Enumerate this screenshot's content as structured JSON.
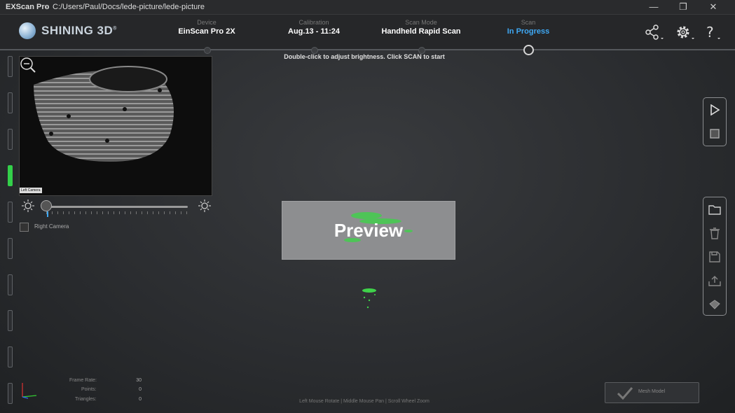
{
  "titlebar": {
    "app": "EXScan Pro",
    "sep": "-",
    "path": "C:/Users/Paul/Docs/lede-picture/lede-picture",
    "minimize": "—",
    "restore": "❐",
    "close": "✕"
  },
  "brand": {
    "name": "SHINING 3D",
    "reg": "®"
  },
  "steps": [
    {
      "label": "Device",
      "value": "EinScan Pro 2X"
    },
    {
      "label": "Calibration",
      "value": "Aug.13 - 11:24"
    },
    {
      "label": "Scan Mode",
      "value": "Handheld Rapid Scan"
    },
    {
      "label": "Scan",
      "value": "In Progress"
    }
  ],
  "hint": "Double-click to adjust brightness. Click SCAN to start",
  "camera": {
    "left_label": "Left Camera",
    "right_label": "Right Camera"
  },
  "preview": {
    "label": "Preview"
  },
  "stats": [
    {
      "label": "Frame Rate:",
      "value": "30"
    },
    {
      "label": "Points:",
      "value": "0"
    },
    {
      "label": "Triangles:",
      "value": "0"
    }
  ],
  "footer": "Left Mouse Rotate | Middle Mouse Pan | Scroll Wheel Zoom",
  "mesh_button": {
    "label": "Mesh Model"
  },
  "colors": {
    "accent": "#3fa9f5",
    "active_green": "#33d04a"
  },
  "icons": [
    "share-icon",
    "gear-icon",
    "help-icon",
    "play-icon",
    "stop-icon",
    "folder-icon",
    "trash-icon",
    "save-icon",
    "export-icon",
    "clear-icon"
  ]
}
